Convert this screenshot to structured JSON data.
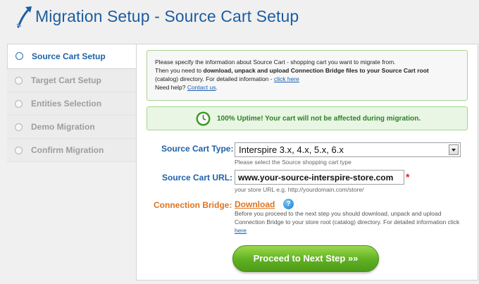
{
  "header": {
    "title": "Migration Setup - Source Cart Setup",
    "logo_icon": "arrow-logo-icon"
  },
  "sidebar": {
    "items": [
      {
        "label": "Source Cart Setup",
        "active": true
      },
      {
        "label": "Target Cart Setup",
        "active": false
      },
      {
        "label": "Entities Selection",
        "active": false
      },
      {
        "label": "Demo Migration",
        "active": false
      },
      {
        "label": "Confirm Migration",
        "active": false
      }
    ]
  },
  "info": {
    "line1": "Please specify the information about Source Cart - shopping cart you want to migrate from.",
    "line2_prefix": "Then you need to ",
    "line2_bold": "download, unpack and upload Connection Bridge files to your Source Cart root",
    "line3_text": "(catalog) directory. For detailed information - ",
    "line3_link": "click here",
    "line4_text": "Need help? ",
    "line4_link": "Contact us",
    "line4_suffix": "."
  },
  "uptime": {
    "icon": "clock-icon",
    "text": "100% Uptime! Your cart will not be affected during migration."
  },
  "form": {
    "cart_type_label": "Source Cart Type:",
    "cart_type_value": "Interspire 3.x, 4.x, 5.x, 6.x",
    "cart_type_hint": "Please select the Source shopping cart type",
    "cart_url_label": "Source Cart URL:",
    "cart_url_value": "www.your-source-interspire-store.com",
    "cart_url_required": "*",
    "cart_url_hint": "your store URL e.g. http://yourdomain.com/store/",
    "bridge_label": "Connection Bridge:",
    "bridge_link": "Download",
    "bridge_help": "?",
    "bridge_desc": "Before you proceed to the next step you should download, unpack and upload Connection Bridge to your store root (catalog) directory. For detailed information click ",
    "bridge_desc_link": "here"
  },
  "actions": {
    "proceed_label": "Proceed to Next Step »»"
  },
  "colors": {
    "title_blue": "#1d5da0",
    "label_orange": "#e0731d",
    "uptime_green": "#2f7f2a",
    "button_green": "#5fb022"
  }
}
